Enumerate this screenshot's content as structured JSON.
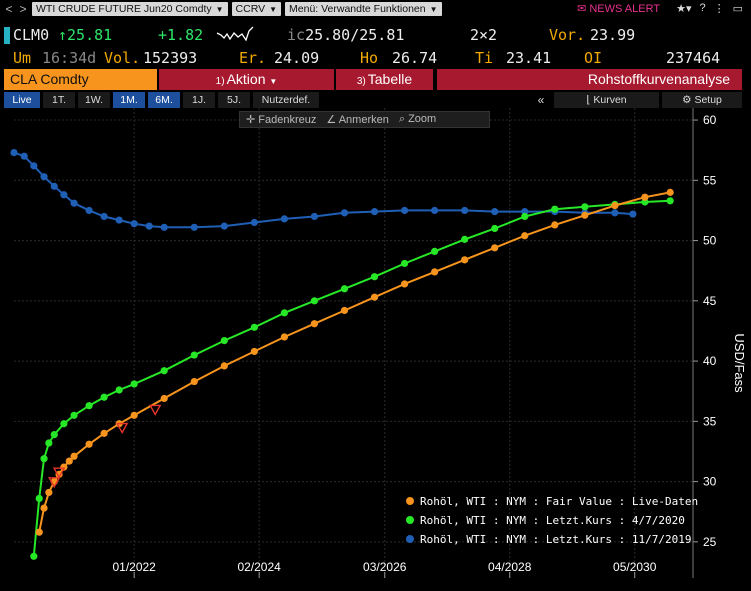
{
  "cmdbar": {
    "back": "<",
    "forward": ">",
    "security_dropdown": "WTI CRUDE FUTURE Jun20 Comdty",
    "function_dropdown": "CCRV",
    "menu_dropdown": "Menü: Verwandte Funktionen",
    "news_alert": "NEWS ALERT"
  },
  "quote": {
    "ticker": "CLM0",
    "last": "↑25.81",
    "change": "+1.82",
    "ic_label": "ic",
    "bid_ask": "25.80/25.81",
    "size": "2×2",
    "prev_label": "Vor.",
    "prev": "23.99",
    "um_label": "Um",
    "time": "16:34d",
    "vol_label": "Vol.",
    "vol": "152393",
    "er_label": "Er.",
    "er": "24.09",
    "ho_label": "Ho",
    "ho": "26.74",
    "ti_label": "Ti",
    "ti": "23.41",
    "oi_label": "OI",
    "oi": "237464"
  },
  "tabs": {
    "security": "CLA Comdty",
    "action_num": "1)",
    "action": "Aktion",
    "table_num": "3)",
    "table": "Tabelle",
    "title": "Rohstoffkurvenanalyse"
  },
  "range": {
    "items": [
      "Live",
      "1T.",
      "1W.",
      "1M.",
      "6M.",
      "1J.",
      "5J.",
      "Nutzerdef."
    ],
    "collapse": "«",
    "curves": "Kurven",
    "setup": "Setup"
  },
  "charttools": {
    "crosshair": "Fadenkreuz",
    "annotate": "Anmerken",
    "zoom": "Zoom"
  },
  "colors": {
    "orange": "#f7941d",
    "green": "#27e827",
    "blue": "#1f5fb5",
    "red_tab": "#a6192e",
    "grid": "#2a2a2a"
  },
  "chart_data": {
    "type": "line",
    "ylabel": "USD/Fass",
    "ylim": [
      22,
      61
    ],
    "yticks": [
      25,
      30,
      35,
      40,
      45,
      50,
      55,
      60
    ],
    "xlim": [
      2020.0,
      2031.3
    ],
    "xticks": [
      {
        "label": "01/2022",
        "x": 2022.0
      },
      {
        "label": "02/2024",
        "x": 2024.08
      },
      {
        "label": "03/2026",
        "x": 2026.17
      },
      {
        "label": "04/2028",
        "x": 2028.25
      },
      {
        "label": "05/2030",
        "x": 2030.33
      }
    ],
    "series": [
      {
        "name": "Rohöl, WTI : NYM : Fair Value : Live-Daten",
        "color": "#f7941d",
        "x": [
          2020.42,
          2020.5,
          2020.58,
          2020.67,
          2020.75,
          2020.83,
          2020.92,
          2021.0,
          2021.25,
          2021.5,
          2021.75,
          2022.0,
          2022.5,
          2023.0,
          2023.5,
          2024.0,
          2024.5,
          2025.0,
          2025.5,
          2026.0,
          2026.5,
          2027.0,
          2027.5,
          2028.0,
          2028.5,
          2029.0,
          2029.5,
          2030.0,
          2030.5,
          2030.92
        ],
        "y": [
          25.8,
          27.8,
          29.1,
          30.0,
          30.6,
          31.2,
          31.7,
          32.1,
          33.1,
          34.0,
          34.8,
          35.5,
          36.9,
          38.3,
          39.6,
          40.8,
          42.0,
          43.1,
          44.2,
          45.3,
          46.4,
          47.4,
          48.4,
          49.4,
          50.4,
          51.3,
          52.1,
          52.9,
          53.6,
          54.0
        ]
      },
      {
        "name": "Rohöl, WTI : NYM : Letzt.Kurs : 4/7/2020",
        "color": "#27e827",
        "x": [
          2020.33,
          2020.42,
          2020.5,
          2020.58,
          2020.67,
          2020.83,
          2021.0,
          2021.25,
          2021.5,
          2021.75,
          2022.0,
          2022.5,
          2023.0,
          2023.5,
          2024.0,
          2024.5,
          2025.0,
          2025.5,
          2026.0,
          2026.5,
          2027.0,
          2027.5,
          2028.0,
          2028.5,
          2029.0,
          2029.5,
          2030.0,
          2030.5,
          2030.92
        ],
        "y": [
          23.8,
          28.6,
          31.9,
          33.2,
          33.9,
          34.8,
          35.5,
          36.3,
          37.0,
          37.6,
          38.1,
          39.2,
          40.5,
          41.7,
          42.8,
          44.0,
          45.0,
          46.0,
          47.0,
          48.1,
          49.1,
          50.1,
          51.0,
          52.0,
          52.6,
          52.8,
          53.0,
          53.2,
          53.3
        ]
      },
      {
        "name": "Rohöl, WTI : NYM : Letzt.Kurs : 11/7/2019",
        "color": "#1f5fb5",
        "x": [
          2020.0,
          2020.17,
          2020.33,
          2020.5,
          2020.67,
          2020.83,
          2021.0,
          2021.25,
          2021.5,
          2021.75,
          2022.0,
          2022.25,
          2022.5,
          2023.0,
          2023.5,
          2024.0,
          2024.5,
          2025.0,
          2025.5,
          2026.0,
          2026.5,
          2027.0,
          2027.5,
          2028.0,
          2028.5,
          2029.0,
          2029.5,
          2030.0,
          2030.3
        ],
        "y": [
          57.3,
          57.0,
          56.2,
          55.3,
          54.5,
          53.8,
          53.1,
          52.5,
          52.0,
          51.7,
          51.4,
          51.2,
          51.1,
          51.1,
          51.2,
          51.5,
          51.8,
          52.0,
          52.3,
          52.4,
          52.5,
          52.5,
          52.5,
          52.4,
          52.4,
          52.4,
          52.3,
          52.3,
          52.2
        ]
      }
    ],
    "markers": {
      "color": "#e8342b",
      "x": [
        2020.67,
        2020.75,
        2021.8,
        2022.35
      ],
      "y": [
        29.9,
        30.7,
        34.4,
        35.9
      ]
    },
    "legend_position": "bottom-right",
    "grid": true
  }
}
